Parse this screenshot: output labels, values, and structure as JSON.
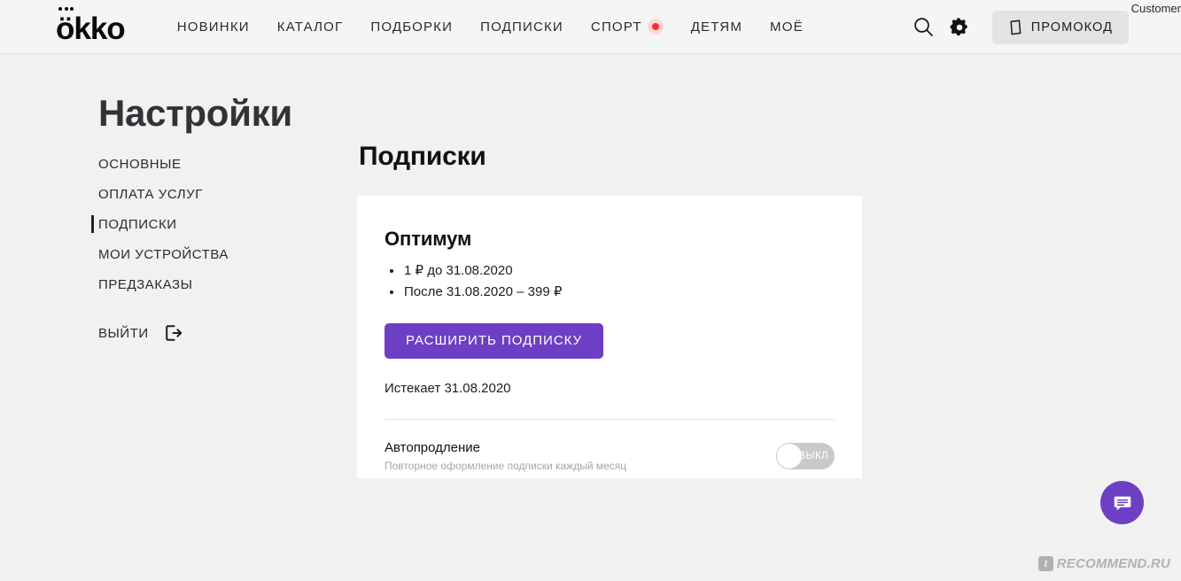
{
  "header": {
    "logo_text": "ökko",
    "nav_items": [
      {
        "label": "НОВИНКИ",
        "badge": false
      },
      {
        "label": "КАТАЛОГ",
        "badge": false
      },
      {
        "label": "ПОДБОРКИ",
        "badge": false
      },
      {
        "label": "ПОДПИСКИ",
        "badge": false
      },
      {
        "label": "СПОРТ",
        "badge": true
      },
      {
        "label": "ДЕТЯМ",
        "badge": false
      },
      {
        "label": "МОЁ",
        "badge": false
      }
    ],
    "search_icon": "search-icon",
    "settings_icon": "gear-icon",
    "promo_label": "ПРОМОКОД",
    "promo_icon": "ticket-icon",
    "customer_label": "Customer"
  },
  "sidebar": {
    "title": "Настройки",
    "items": [
      {
        "label": "ОСНОВНЫЕ",
        "active": false
      },
      {
        "label": "ОПЛАТА УСЛУГ",
        "active": false
      },
      {
        "label": "ПОДПИСКИ",
        "active": true
      },
      {
        "label": "МОИ УСТРОЙСТВА",
        "active": false
      },
      {
        "label": "ПРЕДЗАКАЗЫ",
        "active": false
      }
    ],
    "logout_label": "ВЫЙТИ",
    "logout_icon": "logout-icon"
  },
  "main": {
    "page_title": "Подписки",
    "card": {
      "plan_name": "Оптимум",
      "bullets": [
        "1 ₽ до 31.08.2020",
        "После 31.08.2020 – 399 ₽"
      ],
      "upgrade_button": "РАСШИРИТЬ ПОДПИСКУ",
      "expires_text": "Истекает 31.08.2020",
      "autorenew_title": "Автопродление",
      "autorenew_subtitle": "Повторное оформление подписки каждый месяц",
      "autorenew_state": "ВЫКЛ",
      "autorenew_enabled": false
    }
  },
  "floating": {
    "chat_icon": "chat-bubble-icon",
    "watermark_badge": "I",
    "watermark_text": "RECOMMEND.RU"
  },
  "colors": {
    "accent_purple": "#6d3fc4",
    "sport_dot_red": "#fc2c2c",
    "page_background": "#f1f1f1",
    "card_background": "#ffffff",
    "toggle_off_track": "#c9c9c9"
  }
}
